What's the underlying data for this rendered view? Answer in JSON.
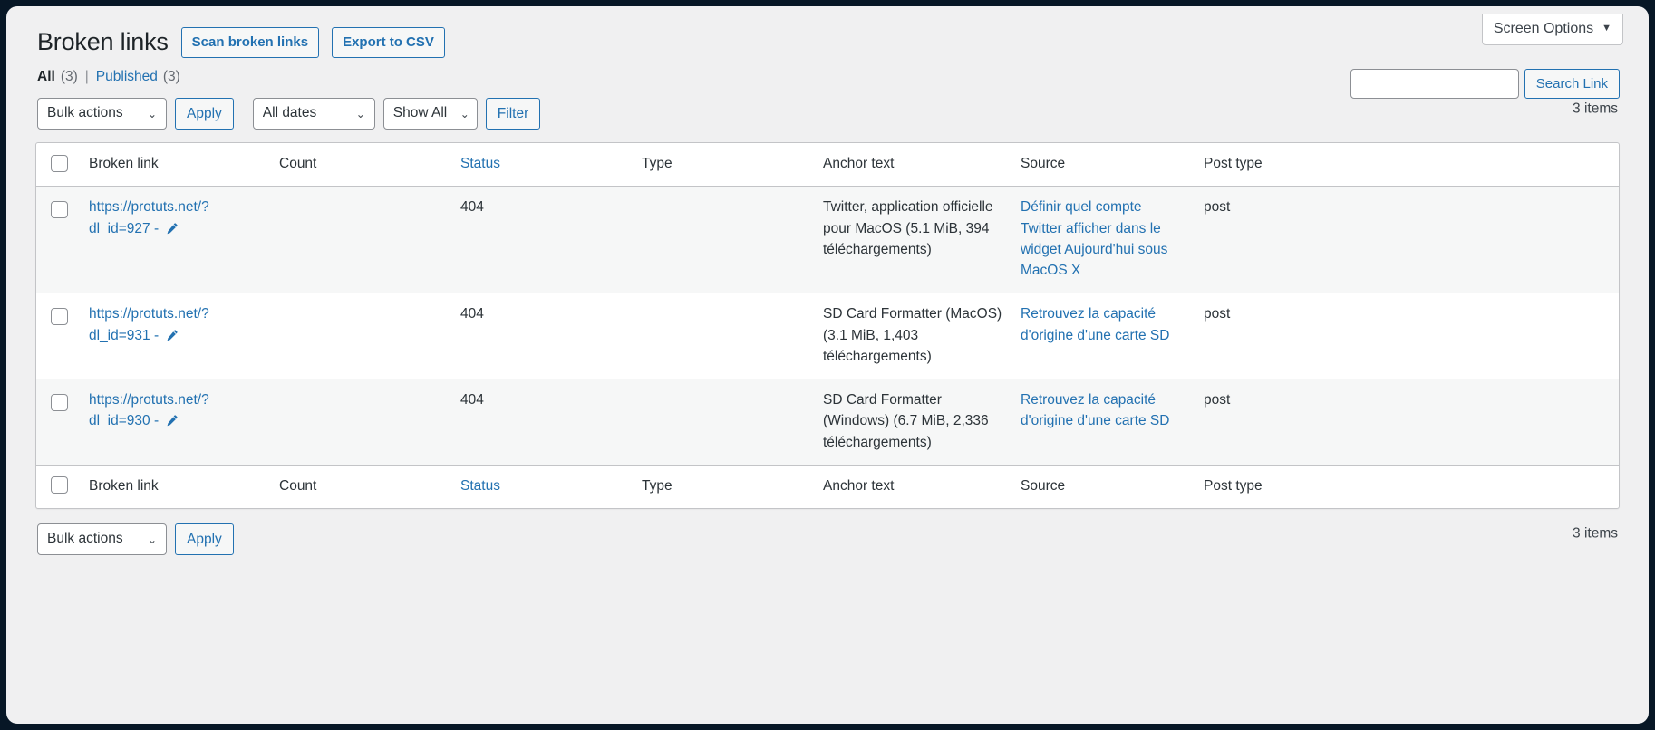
{
  "screen_options": {
    "label": "Screen Options",
    "caret": "chevron-down-icon"
  },
  "header": {
    "title": "Broken links",
    "actions": [
      {
        "label": "Scan broken links",
        "name": "scan-broken-links-button"
      },
      {
        "label": "Export to CSV",
        "name": "export-to-csv-button"
      }
    ]
  },
  "views": {
    "all_label": "All",
    "all_count": "(3)",
    "separator": "|",
    "published_label": "Published",
    "published_count": "(3)"
  },
  "search": {
    "value": "",
    "placeholder": "",
    "button_label": "Search Link"
  },
  "tablenav_top": {
    "bulk_actions": "Bulk actions",
    "bulk_options": [
      "Bulk actions"
    ],
    "apply_label": "Apply",
    "dates": "All dates",
    "dates_options": [
      "All dates"
    ],
    "show_all": "Show All",
    "show_all_options": [
      "Show All"
    ],
    "filter_label": "Filter",
    "displaying_num": "3 items"
  },
  "tablenav_bottom": {
    "bulk_actions": "Bulk actions",
    "bulk_options": [
      "Bulk actions"
    ],
    "apply_label": "Apply",
    "displaying_num": "3 items"
  },
  "table": {
    "columns": [
      {
        "key": "link",
        "label": "Broken link",
        "sortable": false
      },
      {
        "key": "count",
        "label": "Count",
        "sortable": false
      },
      {
        "key": "status",
        "label": "Status",
        "sortable": true
      },
      {
        "key": "type",
        "label": "Type",
        "sortable": false
      },
      {
        "key": "anchor",
        "label": "Anchor text",
        "sortable": false
      },
      {
        "key": "source",
        "label": "Source",
        "sortable": false
      },
      {
        "key": "posttype",
        "label": "Post type",
        "sortable": false
      }
    ],
    "rows": [
      {
        "link": "https://protuts.net/?dl_id=927 - ",
        "edit_icon": "pencil-icon",
        "count": "",
        "status": "404",
        "type": "",
        "anchor": "Twitter, application officielle pour MacOS (5.1 MiB, 394 téléchargements)",
        "source": "Définir quel compte Twitter afficher dans le widget Aujourd'hui sous MacOS X",
        "posttype": "post"
      },
      {
        "link": "https://protuts.net/?dl_id=931 - ",
        "edit_icon": "pencil-icon",
        "count": "",
        "status": "404",
        "type": "",
        "anchor": "SD Card Formatter (MacOS) (3.1 MiB, 1,403 téléchargements)",
        "source": "Retrouvez la capacité d'origine d'une carte SD",
        "posttype": "post"
      },
      {
        "link": "https://protuts.net/?dl_id=930 - ",
        "edit_icon": "pencil-icon",
        "count": "",
        "status": "404",
        "type": "",
        "anchor": "SD Card Formatter (Windows) (6.7 MiB, 2,336 téléchargements)",
        "source": "Retrouvez la capacité d'origine d'une carte SD",
        "posttype": "post"
      }
    ]
  },
  "colors": {
    "accent": "#2271b1",
    "text": "#2c3338",
    "muted": "#646970",
    "page_bg": "#f0f0f1",
    "border": "#c3c4c7"
  }
}
